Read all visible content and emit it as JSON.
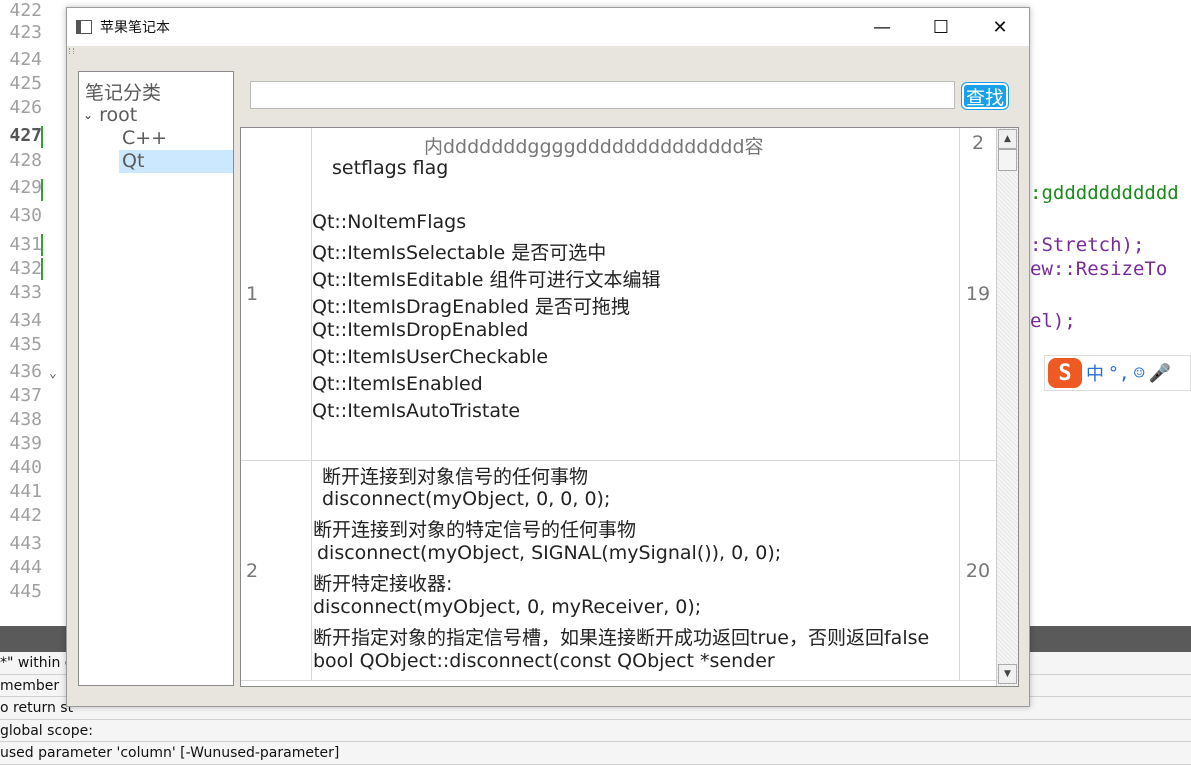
{
  "editor": {
    "line_numbers": [
      "422",
      "423",
      "424",
      "425",
      "426",
      "427",
      "428",
      "429",
      "430",
      "431",
      "432",
      "433",
      "434",
      "435",
      "436",
      "437",
      "438",
      "439",
      "440",
      "441",
      "442",
      "443",
      "444",
      "445"
    ],
    "current_line": "427",
    "code_fragments": [
      ":gddddddddddd",
      ":Stretch);",
      "ew::ResizeTo",
      "el);"
    ]
  },
  "ime": {
    "mode": "中",
    "punct": "°,",
    "logo": "S"
  },
  "issues": [
    "*\" within c",
    "member",
    "o return st",
    "global scope:",
    "used parameter 'column' [-Wunused-parameter]"
  ],
  "window": {
    "title": "苹果笔记本",
    "minimize": "—",
    "maximize": "☐",
    "close": "✕"
  },
  "tree": {
    "header": "笔记分类",
    "root": "root",
    "children": [
      "C++",
      "Qt"
    ],
    "selected": "Qt"
  },
  "search": {
    "value": "",
    "placeholder": "",
    "button": "查找"
  },
  "table": {
    "rows": [
      {
        "id": "1",
        "num_top": "2",
        "num": "19",
        "lines": [
          "内dddddddggggdddddddddddddd容",
          "setflags        flag",
          "",
          "Qt::NoItemFlags",
          "Qt::ItemIsSelectable  是否可选中",
          "Qt::ItemIsEditable        组件可进行文本编辑",
          "Qt::ItemIsDragEnabled  是否可拖拽",
          "Qt::ItemIsDropEnabled",
          "Qt::ItemIsUserCheckable",
          "Qt::ItemIsEnabled",
          "Qt::ItemIsAutoTristate"
        ]
      },
      {
        "id": "2",
        "num": "20",
        "lines": [
          "断开连接到对象信号的任何事物",
          "disconnect(myObject, 0, 0, 0);",
          "断开连接到对象的特定信号的任何事物",
          "disconnect(myObject, SIGNAL(mySignal()), 0, 0);",
          "断开特定接收器:",
          "disconnect(myObject, 0, myReceiver, 0);",
          "断开指定对象的指定信号槽，如果连接断开成功返回true，否则返回false",
          "bool QObject::disconnect(const QObject *sender"
        ]
      }
    ]
  }
}
